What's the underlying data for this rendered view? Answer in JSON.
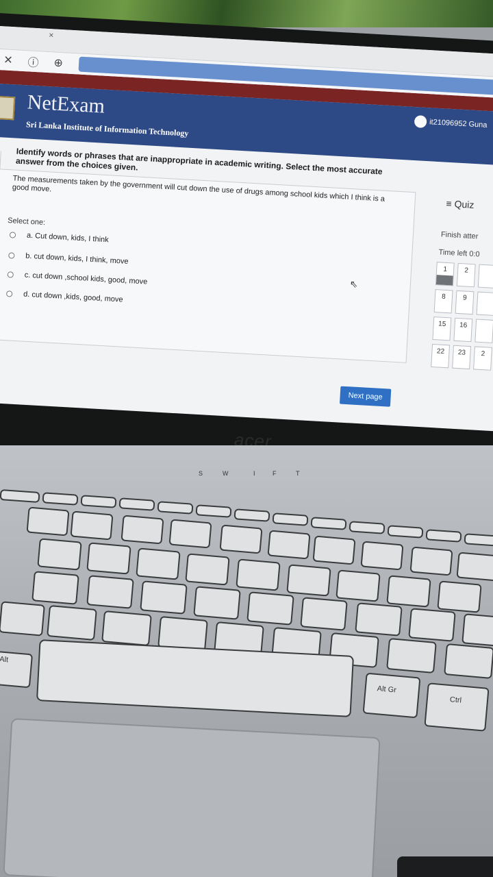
{
  "browser": {
    "tab_close": "×",
    "close_icon_glyph": "✕",
    "info_icon_glyph": "ⓘ",
    "bookmark_icon_glyph": "⊕"
  },
  "header": {
    "brand": "NetExam",
    "subtitle": "Sri Lanka Institute of Information Technology",
    "user": "it21096952 Guna"
  },
  "question": {
    "instruction": "Identify words or phrases that are inappropriate in academic writing. Select the most accurate answer from the choices given.",
    "stem": "The measurements taken by the government will cut down the use of drugs among school kids which I think is a good move.",
    "select_label": "Select one:",
    "options": [
      "a. Cut down, kids, I think",
      "b. cut down, kids, I think, move",
      "c. cut down ,school kids, good, move",
      "d. cut down ,kids, good, move"
    ]
  },
  "quiz_nav": {
    "title": "≡ Quiz",
    "finish": "Finish atter",
    "time_left": "Time left 0:0",
    "numbers": [
      "1",
      "2",
      "",
      "8",
      "9",
      "",
      "15",
      "16",
      "",
      "22",
      "23",
      "2"
    ]
  },
  "next_button": "Next page",
  "laptop": {
    "brand": "acer",
    "keys": {
      "top_labels": [
        "S",
        "W",
        "I",
        "F",
        "T"
      ],
      "alt_left": "Alt",
      "alt_gr": "Alt Gr",
      "ctrl": "Ctrl"
    }
  }
}
